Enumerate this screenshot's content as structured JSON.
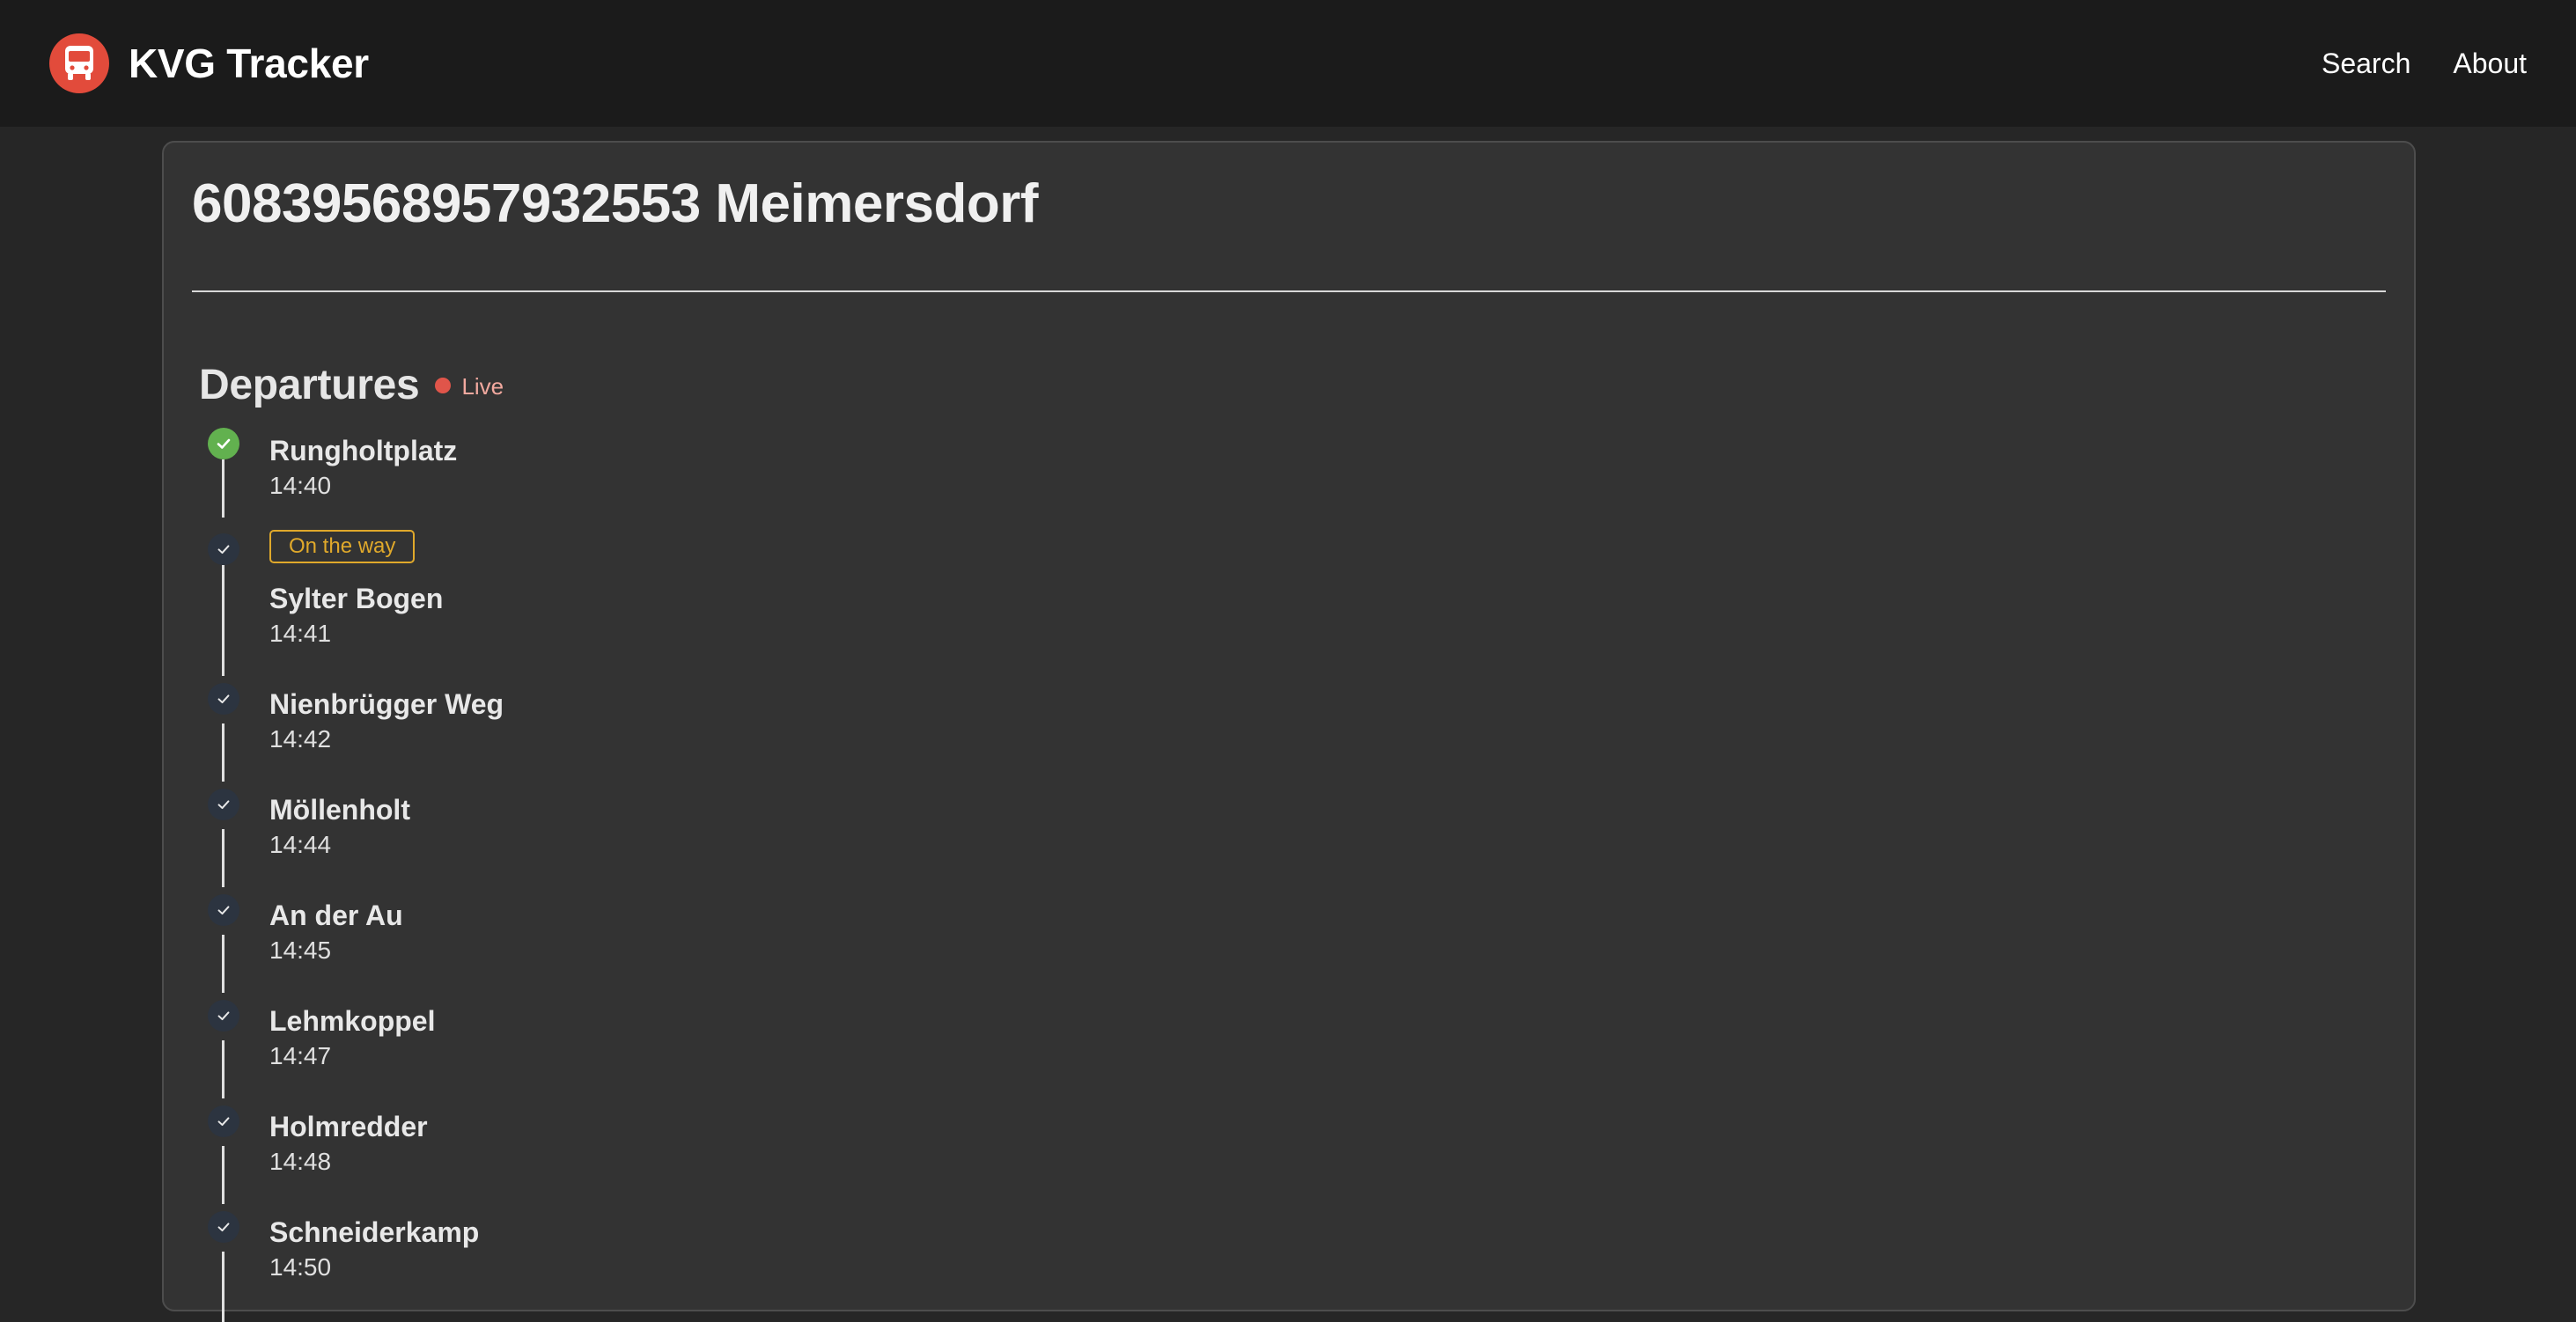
{
  "header": {
    "brand": "KVG Tracker",
    "logo_icon": "bus-icon",
    "nav": [
      {
        "label": "Search"
      },
      {
        "label": "About"
      }
    ]
  },
  "stop": {
    "title": "6083956895793255З Meimersdorf"
  },
  "departures": {
    "title": "Departures",
    "live_label": "Live",
    "stops": [
      {
        "name": "Rungholtplatz",
        "time": "14:40",
        "status": "passed"
      },
      {
        "name": "Sylter Bogen",
        "time": "14:41",
        "status": "pending",
        "badge": "On the way"
      },
      {
        "name": "Nienbrügger Weg",
        "time": "14:42",
        "status": "pending"
      },
      {
        "name": "Möllenholt",
        "time": "14:44",
        "status": "pending"
      },
      {
        "name": "An der Au",
        "time": "14:45",
        "status": "pending"
      },
      {
        "name": "Lehmkoppel",
        "time": "14:47",
        "status": "pending"
      },
      {
        "name": "Holmredder",
        "time": "14:48",
        "status": "pending"
      },
      {
        "name": "Schneiderkamp",
        "time": "14:50",
        "status": "pending"
      }
    ]
  },
  "colors": {
    "accent_red": "#e24b3b",
    "passed_green": "#62b14f",
    "badge_orange": "#e0a92b",
    "live_red": "#e0554a"
  }
}
